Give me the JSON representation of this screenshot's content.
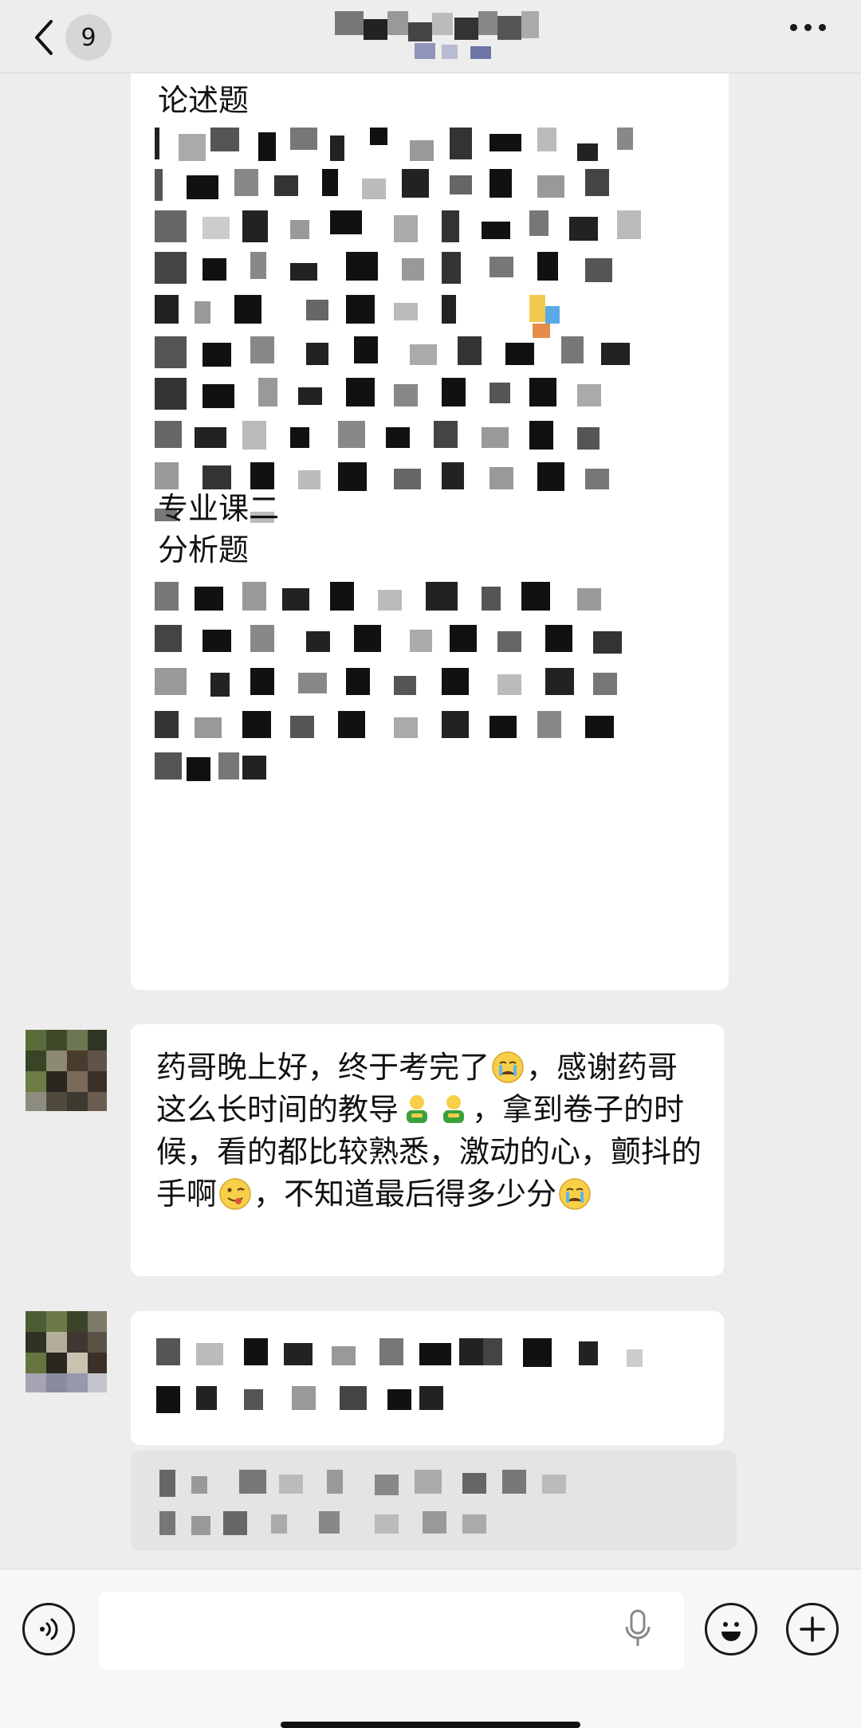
{
  "header": {
    "unread_count": "9",
    "title_censored": true,
    "back_icon": "chevron-left-icon",
    "more_icon": "more-dots-icon"
  },
  "messages": [
    {
      "sender": "other",
      "partially_censored": true,
      "visible_lines": [
        "论述题",
        "专业课二",
        "分析题"
      ]
    },
    {
      "sender": "other",
      "segments": [
        "药哥晚上好，终于考完了",
        "，感谢药哥这么长时间的教导",
        "，拿到卷子的时候，看的都比较熟悉，激动的心，颤抖的手啊",
        "，不知道最后得多少分"
      ],
      "emoji": [
        "crying-face-icon",
        "bowing-person-icon",
        "bowing-person-icon",
        "winking-tongue-face-icon",
        "crying-face-icon"
      ]
    },
    {
      "sender": "other",
      "censored": true
    },
    {
      "sender": "other",
      "censored": true,
      "type": "quote"
    }
  ],
  "input_bar": {
    "placeholder": "",
    "voice_icon": "voice-icon",
    "mic_icon": "microphone-icon",
    "emoji_icon": "emoji-icon",
    "plus_icon": "plus-icon"
  }
}
